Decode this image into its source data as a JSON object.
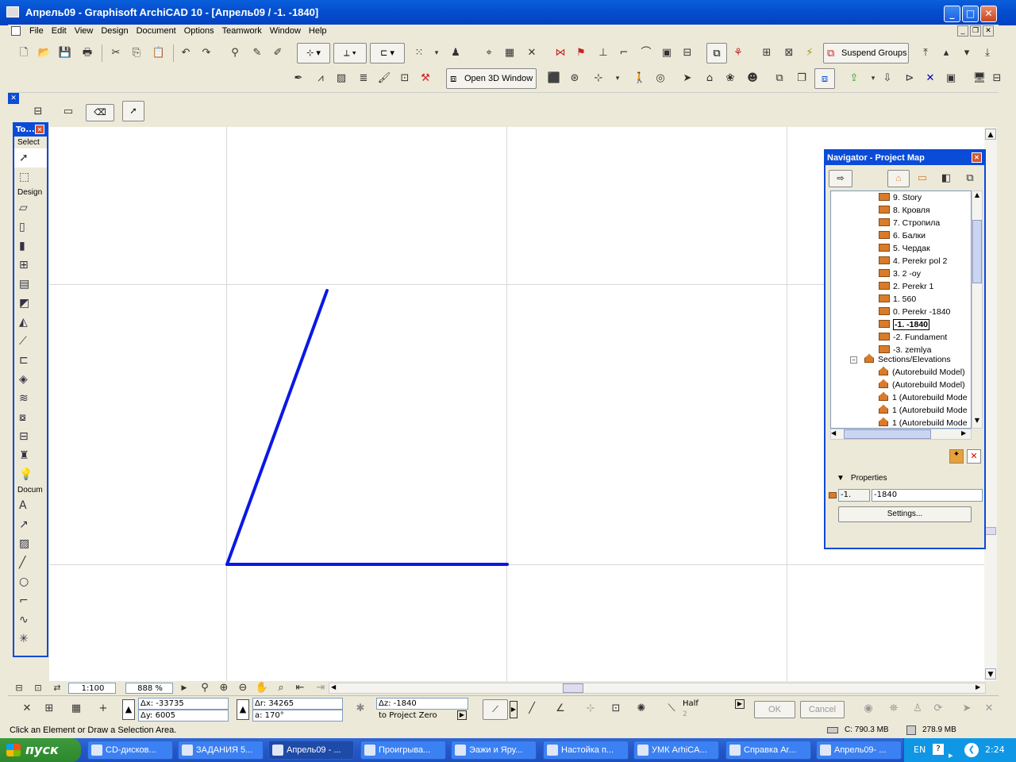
{
  "window": {
    "title": "Апрель09 - Graphisoft ArchiCAD 10 - [Апрель09 / -1. -1840]"
  },
  "menu": [
    "File",
    "Edit",
    "View",
    "Design",
    "Document",
    "Options",
    "Teamwork",
    "Window",
    "Help"
  ],
  "toolbar": {
    "suspend_groups": "Suspend Groups",
    "open_3d": "Open 3D Window"
  },
  "toolbox": {
    "title": "To...",
    "sections": {
      "select": "Select",
      "design": "Design",
      "document": "Docum"
    }
  },
  "navigator": {
    "title": "Navigator - Project Map",
    "stories": [
      "9. Story",
      "8. Кровля",
      "7. Стропила",
      "6. Балки",
      "5. Чердак",
      "4. Perekr pol 2",
      "3. 2 -oy",
      "2. Perekr 1",
      "1. 560",
      "0. Perekr -1840",
      "-1. -1840",
      "-2. Fundament",
      "-3. zemlya"
    ],
    "selected_story": "-1. -1840",
    "sections_label": "Sections/Elevations",
    "sections": [
      "(Autorebuild Model)",
      "(Autorebuild Model)",
      "1 (Autorebuild Mode",
      "1 (Autorebuild Mode",
      "1 (Autorebuild Mode"
    ],
    "properties_label": "Properties",
    "prop_id": "-1.",
    "prop_name": "-1840",
    "settings_label": "Settings..."
  },
  "nav_bar": {
    "scale": "1:100",
    "zoom": "888 %"
  },
  "info_box": {
    "dx": "Δx: -33735",
    "dy": "Δy: 6005",
    "dr": "Δr: 34265",
    "a": "a:  170°",
    "dz": "Δz: -1840",
    "to_zero": "to Project Zero",
    "half": "Half",
    "half_n": "2",
    "ok": "OK",
    "cancel": "Cancel"
  },
  "status": {
    "message": "Click an Element or Draw a Selection Area.",
    "disk": "C: 790.3 MB",
    "mem": "278.9 MB"
  },
  "taskbar": {
    "start": "пуск",
    "tasks": [
      "CD-дисков...",
      "ЗАДАНИЯ 5...",
      "Апрель09 - ...",
      "Проигрыва...",
      "Эажи и Яру...",
      "Настойка п...",
      "УМК ArhiCA...",
      "Справка Ar...",
      "Апрель09- ..."
    ],
    "lang": "EN",
    "clock": "2:24"
  },
  "colors": {
    "drawing_line": "#0A18E6",
    "title_bar": "#0550D0",
    "nav_header": "#0A4BD8"
  }
}
